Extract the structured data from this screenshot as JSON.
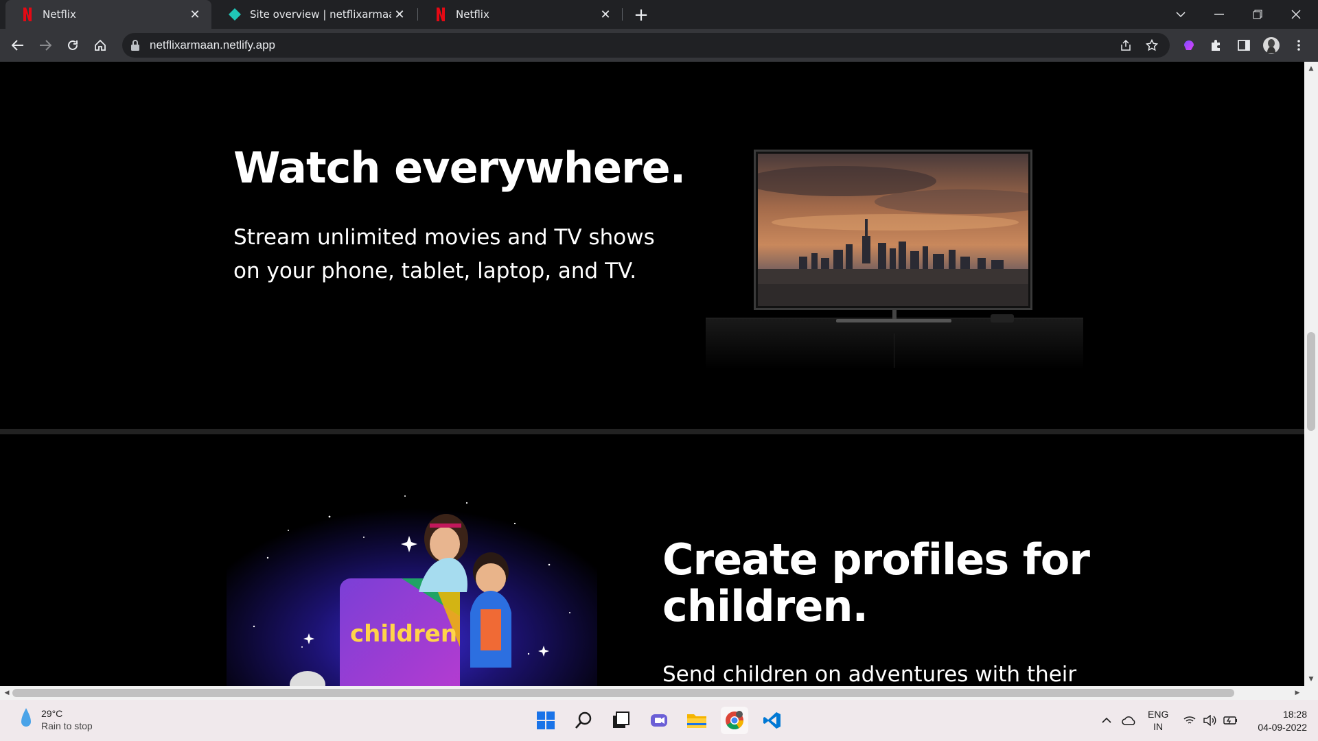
{
  "browser": {
    "tabs": [
      {
        "title": "Netflix",
        "favicon": "netflix-icon",
        "active": true
      },
      {
        "title": "Site overview | netflixarmaan",
        "favicon": "netlify-icon",
        "active": false
      },
      {
        "title": "Netflix",
        "favicon": "netflix-icon",
        "active": false
      }
    ],
    "url": "netflixarmaan.netlify.app"
  },
  "page": {
    "watch": {
      "title": "Watch everywhere.",
      "line1": "Stream unlimited movies and TV shows",
      "line2": "on your phone, tablet, laptop, and TV."
    },
    "kids": {
      "title_line1": "Create profiles for",
      "title_line2": "children.",
      "subtitle_partial": "Send children on adventures with their",
      "art_label": "children"
    }
  },
  "taskbar": {
    "weather_temp": "29°C",
    "weather_desc": "Rain to stop",
    "lang_top": "ENG",
    "lang_bottom": "IN",
    "time": "18:28",
    "date": "04-09-2022"
  },
  "colors": {
    "netflix_red": "#e50914",
    "page_bg": "#000000",
    "chrome_dark": "#202124",
    "chrome_toolbar": "#35363a"
  }
}
